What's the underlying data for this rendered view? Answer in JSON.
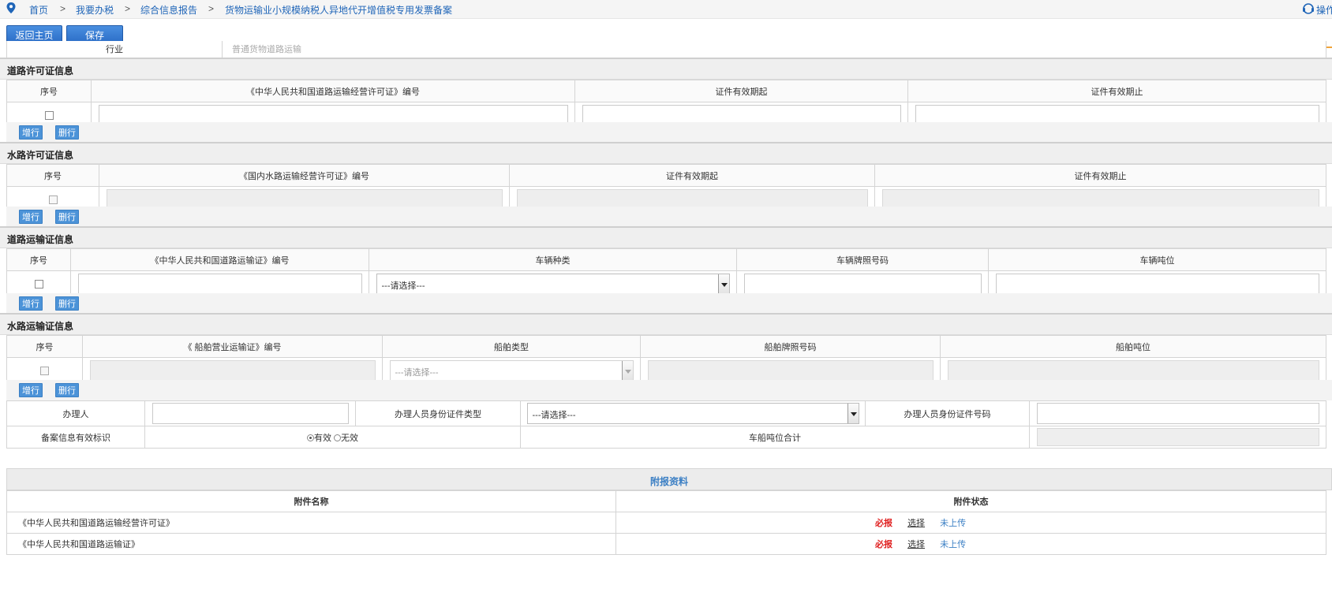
{
  "breadcrumb": {
    "items": [
      "首页",
      "我要办税",
      "综合信息报告",
      "货物运输业小规模纳税人异地代开增值税专用发票备案"
    ],
    "separator": ">",
    "help_label": "操作"
  },
  "toolbar": {
    "home_label": "返回主页",
    "save_label": "保存"
  },
  "industry": {
    "label": "行业",
    "value": "普通货物道路运输"
  },
  "sections": {
    "road_permit": {
      "title": "道路许可证信息",
      "columns": [
        "序号",
        "《中华人民共和国道路运输经营许可证》编号",
        "证件有效期起",
        "证件有效期止"
      ]
    },
    "water_permit": {
      "title": "水路许可证信息",
      "columns": [
        "序号",
        "《国内水路运输经营许可证》编号",
        "证件有效期起",
        "证件有效期止"
      ]
    },
    "road_transport": {
      "title": "道路运输证信息",
      "columns": [
        "序号",
        "《中华人民共和国道路运输证》编号",
        "车辆种类",
        "车辆牌照号码",
        "车辆吨位"
      ],
      "select_placeholder": "---请选择---"
    },
    "water_transport": {
      "title": "水路运输证信息",
      "columns": [
        "序号",
        "《 船舶营业运输证》编号",
        "船舶类型",
        "船舶牌照号码",
        "船舶吨位"
      ],
      "select_placeholder": "---请选择---"
    }
  },
  "row_buttons": {
    "add": "增行",
    "delete": "删行"
  },
  "handler": {
    "handler_label": "办理人",
    "id_type_label": "办理人员身份证件类型",
    "id_type_value": "---请选择---",
    "id_number_label": "办理人员身份证件号码",
    "valid_flag_label": "备案信息有效标识",
    "valid_option": "有效",
    "invalid_option": "无效",
    "valid_selected": "有效",
    "tonnage_total_label": "车船吨位合计"
  },
  "attachments": {
    "title": "附报资料",
    "col_name": "附件名称",
    "col_status": "附件状态",
    "rows": [
      {
        "name": "《中华人民共和国道路运输经营许可证》",
        "required": "必报",
        "action": "选择",
        "status": "未上传"
      },
      {
        "name": "《中华人民共和国道路运输证》",
        "required": "必报",
        "action": "选择",
        "status": "未上传"
      }
    ]
  },
  "colors": {
    "link": "#1f65b8",
    "accent_line": "#f0a43a",
    "button": "#2a6cc6",
    "required": "#e02020"
  }
}
